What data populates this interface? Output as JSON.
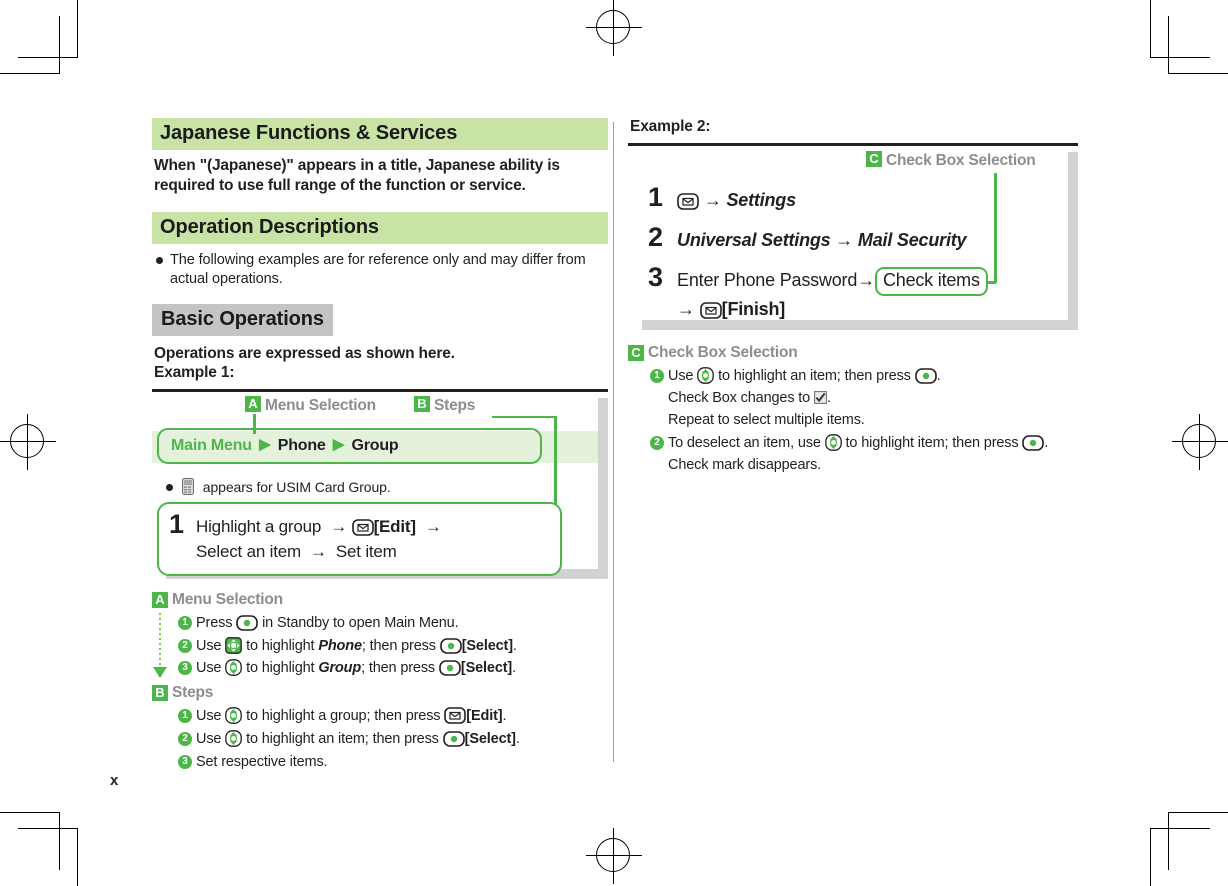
{
  "page": {
    "number": "x",
    "accent_green": "#4cb648",
    "band_green": "#c9e3a7",
    "band_gray": "#c4c4c4",
    "light_green": "#e4f2dc",
    "shadow_gray": "#d2d2d2",
    "callout_title_gray": "#8d8d8d"
  },
  "left": {
    "heading1": "Japanese Functions & Services",
    "lead_line1": "When \"(Japanese)\" appears in a title, Japanese ability is",
    "lead_line2": "required to use full range of the function or service.",
    "heading2": "Operation Descriptions",
    "bullet1": "The following examples are for reference only and may differ from actual operations.",
    "heading3": "Basic Operations",
    "subhead": "Operations are expressed as shown here.",
    "example_label": "Example 1:",
    "example1": {
      "callout_a_letter": "A",
      "callout_a_title": "Menu Selection",
      "callout_b_letter": "B",
      "callout_b_title": "Steps",
      "menu_path": {
        "root": "Main Menu",
        "item1": "Phone",
        "item2": "Group"
      },
      "note": "appears for USIM Card Group.",
      "note_icon": "usim-card-icon",
      "step": {
        "number": "1",
        "line1_a": "Highlight a group",
        "line1_key": "mail-key-icon",
        "line1_b": "[Edit]",
        "line2_a": "Select an item",
        "line2_b": "Set item"
      }
    },
    "callout_a": {
      "letter": "A",
      "title": "Menu Selection",
      "items": [
        {
          "num": "1",
          "pre": "Press ",
          "key": "center-key-icon",
          "post": " in Standby to open Main Menu."
        },
        {
          "num": "2",
          "pre": "Use ",
          "key": "navigation-4way-key-icon",
          "mid": " to highlight ",
          "emph": "Phone",
          "mid2": "; then press ",
          "key2": "center-key-icon",
          "label": "[Select]",
          "post": "."
        },
        {
          "num": "3",
          "pre": "Use ",
          "key": "navigation-updown-key-icon",
          "mid": " to highlight ",
          "emph": "Group",
          "mid2": "; then press ",
          "key2": "center-key-icon",
          "label": "[Select]",
          "post": "."
        }
      ]
    },
    "callout_b": {
      "letter": "B",
      "title": "Steps",
      "items": [
        {
          "num": "1",
          "pre": "Use ",
          "key": "navigation-updown-key-icon",
          "mid": " to highlight a group; then press ",
          "key2": "mail-key-icon",
          "label": "[Edit]",
          "post": "."
        },
        {
          "num": "2",
          "pre": "Use ",
          "key": "navigation-updown-key-icon",
          "mid": " to highlight an item; then press ",
          "key2": "center-key-icon",
          "label": "[Select]",
          "post": "."
        },
        {
          "num": "3",
          "pre": "Set respective items.",
          "key": "",
          "mid": "",
          "key2": "",
          "label": "",
          "post": ""
        }
      ]
    }
  },
  "right": {
    "example_label": "Example 2:",
    "example2": {
      "callout_c_letter": "C",
      "callout_c_title": "Check Box Selection",
      "steps": [
        {
          "number": "1",
          "key": "mail-key-icon",
          "arrow": "→",
          "target": "Settings"
        },
        {
          "number": "2",
          "part1": "Universal Settings",
          "arrow": "→",
          "part2": "Mail Security"
        },
        {
          "number": "3",
          "part1": "Enter Phone Password",
          "arrow": "→",
          "highlight": "Check items",
          "arrow2": "→",
          "key": "mail-key-icon",
          "part2": "[Finish]"
        }
      ]
    },
    "callout_c": {
      "letter": "C",
      "title": "Check Box Selection",
      "items": [
        {
          "num": "1",
          "pre": "Use ",
          "key": "navigation-updown-key-icon",
          "mid": " to highlight an item; then press ",
          "key2": "center-key-icon",
          "post": ".",
          "sub1_a": "Check Box changes to ",
          "sub1_icon": "checkbox-checked-icon",
          "sub1_b": ".",
          "sub2": "Repeat to select multiple items."
        },
        {
          "num": "2",
          "pre": "To deselect an item, use ",
          "key": "navigation-updown-key-icon",
          "mid": " to highlight item; then press ",
          "key2": "center-key-icon",
          "post": ".",
          "sub1_a": "Check mark disappears.",
          "sub1_icon": "",
          "sub1_b": "",
          "sub2": ""
        }
      ]
    }
  }
}
